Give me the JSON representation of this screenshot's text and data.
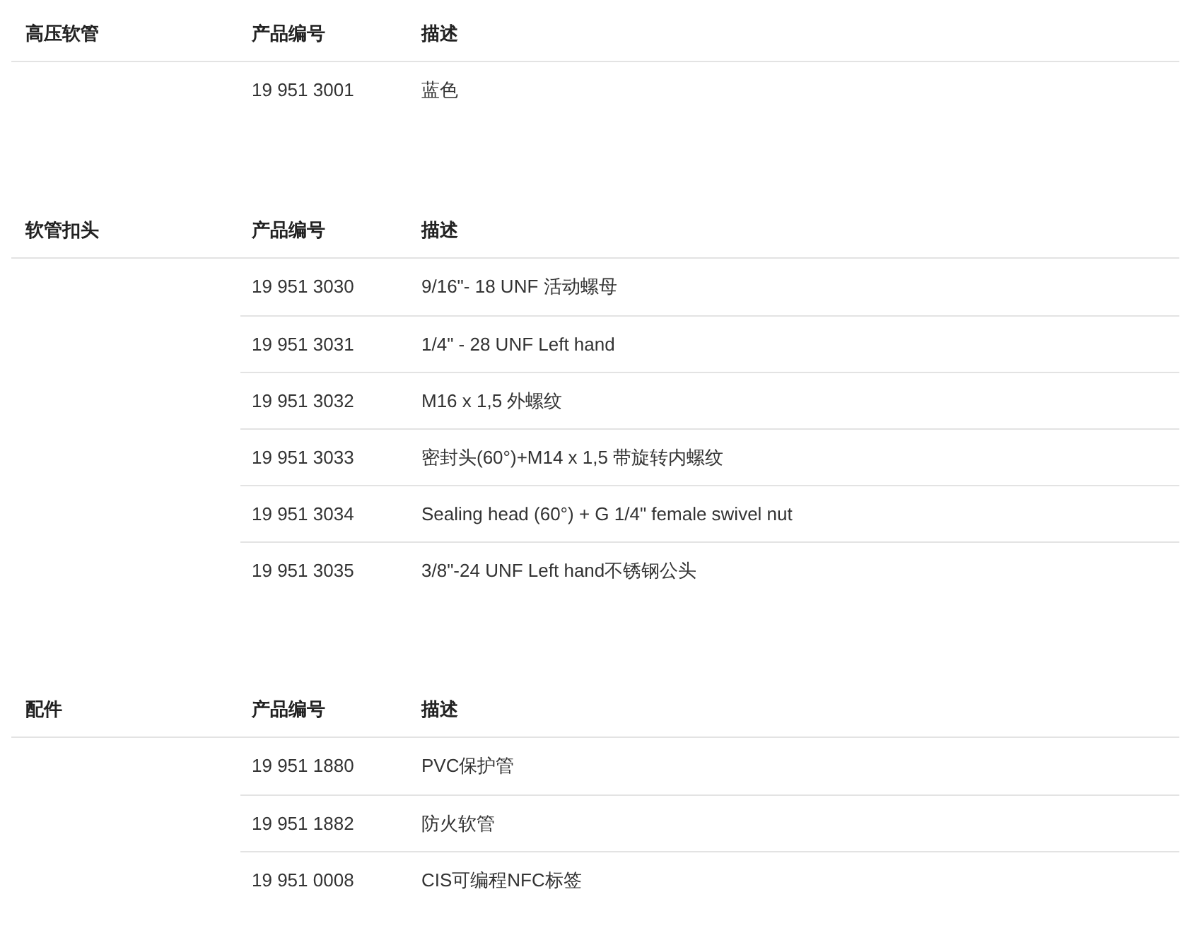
{
  "sections": [
    {
      "title": "高压软管",
      "columns": [
        "产品编号",
        "描述"
      ],
      "rows": [
        {
          "number": "19 951 3001",
          "description": "蓝色"
        }
      ]
    },
    {
      "title": "软管扣头",
      "columns": [
        "产品编号",
        "描述"
      ],
      "rows": [
        {
          "number": "19 951 3030",
          "description": "9/16\"- 18 UNF 活动螺母"
        },
        {
          "number": "19 951 3031",
          "description": "1/4\" - 28 UNF Left hand"
        },
        {
          "number": "19 951 3032",
          "description": "M16 x 1,5 外螺纹"
        },
        {
          "number": "19 951 3033",
          "description": "密封头(60°)+M14 x 1,5 带旋转内螺纹"
        },
        {
          "number": "19 951 3034",
          "description": "Sealing head (60°) + G 1/4\" female swivel nut"
        },
        {
          "number": "19 951 3035",
          "description": "3/8\"-24 UNF Left hand不锈钢公头"
        }
      ]
    },
    {
      "title": "配件",
      "columns": [
        "产品编号",
        "描述"
      ],
      "rows": [
        {
          "number": "19 951 1880",
          "description": "PVC保护管"
        },
        {
          "number": "19 951 1882",
          "description": "防火软管"
        },
        {
          "number": "19 951 0008",
          "description": "CIS可编程NFC标签"
        }
      ]
    }
  ]
}
